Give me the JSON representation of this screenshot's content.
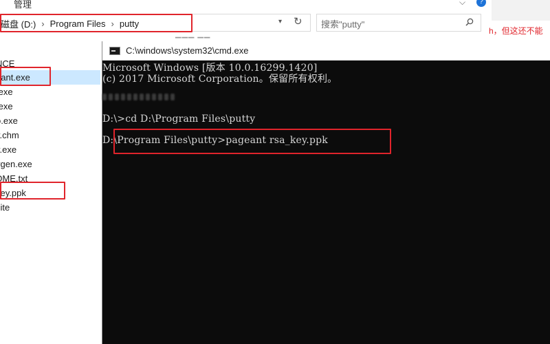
{
  "explorer": {
    "ribbon_tab": "管理",
    "breadcrumbs": [
      "磁盘 (D:)",
      "Program Files",
      "putty"
    ],
    "search_placeholder": "搜索\"putty\"",
    "files": [
      "NCE",
      "eant.exe",
      ".exe",
      ".exe",
      "o.exe",
      "y.chm",
      "y.exe",
      "ygen.exe",
      "DME.txt",
      "key.ppk",
      "site"
    ],
    "selected_file": "eant.exe",
    "right_red_text": "h，但这还不能"
  },
  "cmd": {
    "title": "C:\\windows\\system32\\cmd.exe",
    "lines": [
      "Microsoft Windows [版本 10.0.16299.1420]",
      "(c) 2017 Microsoft Corporation。保留所有权利。",
      "D:\\>cd D:\\Program Files\\putty",
      "D:\\Program Files\\putty>pageant rsa_key.ppk"
    ]
  },
  "colors": {
    "highlight_red": "#e0242b",
    "terminal_bg": "#0c0c0c",
    "terminal_text": "#d6d6d6",
    "selection_blue": "#cce8ff"
  },
  "icons": [
    "search-icon",
    "refresh-icon",
    "chevron-down-icon",
    "help-icon",
    "cmd-icon"
  ]
}
